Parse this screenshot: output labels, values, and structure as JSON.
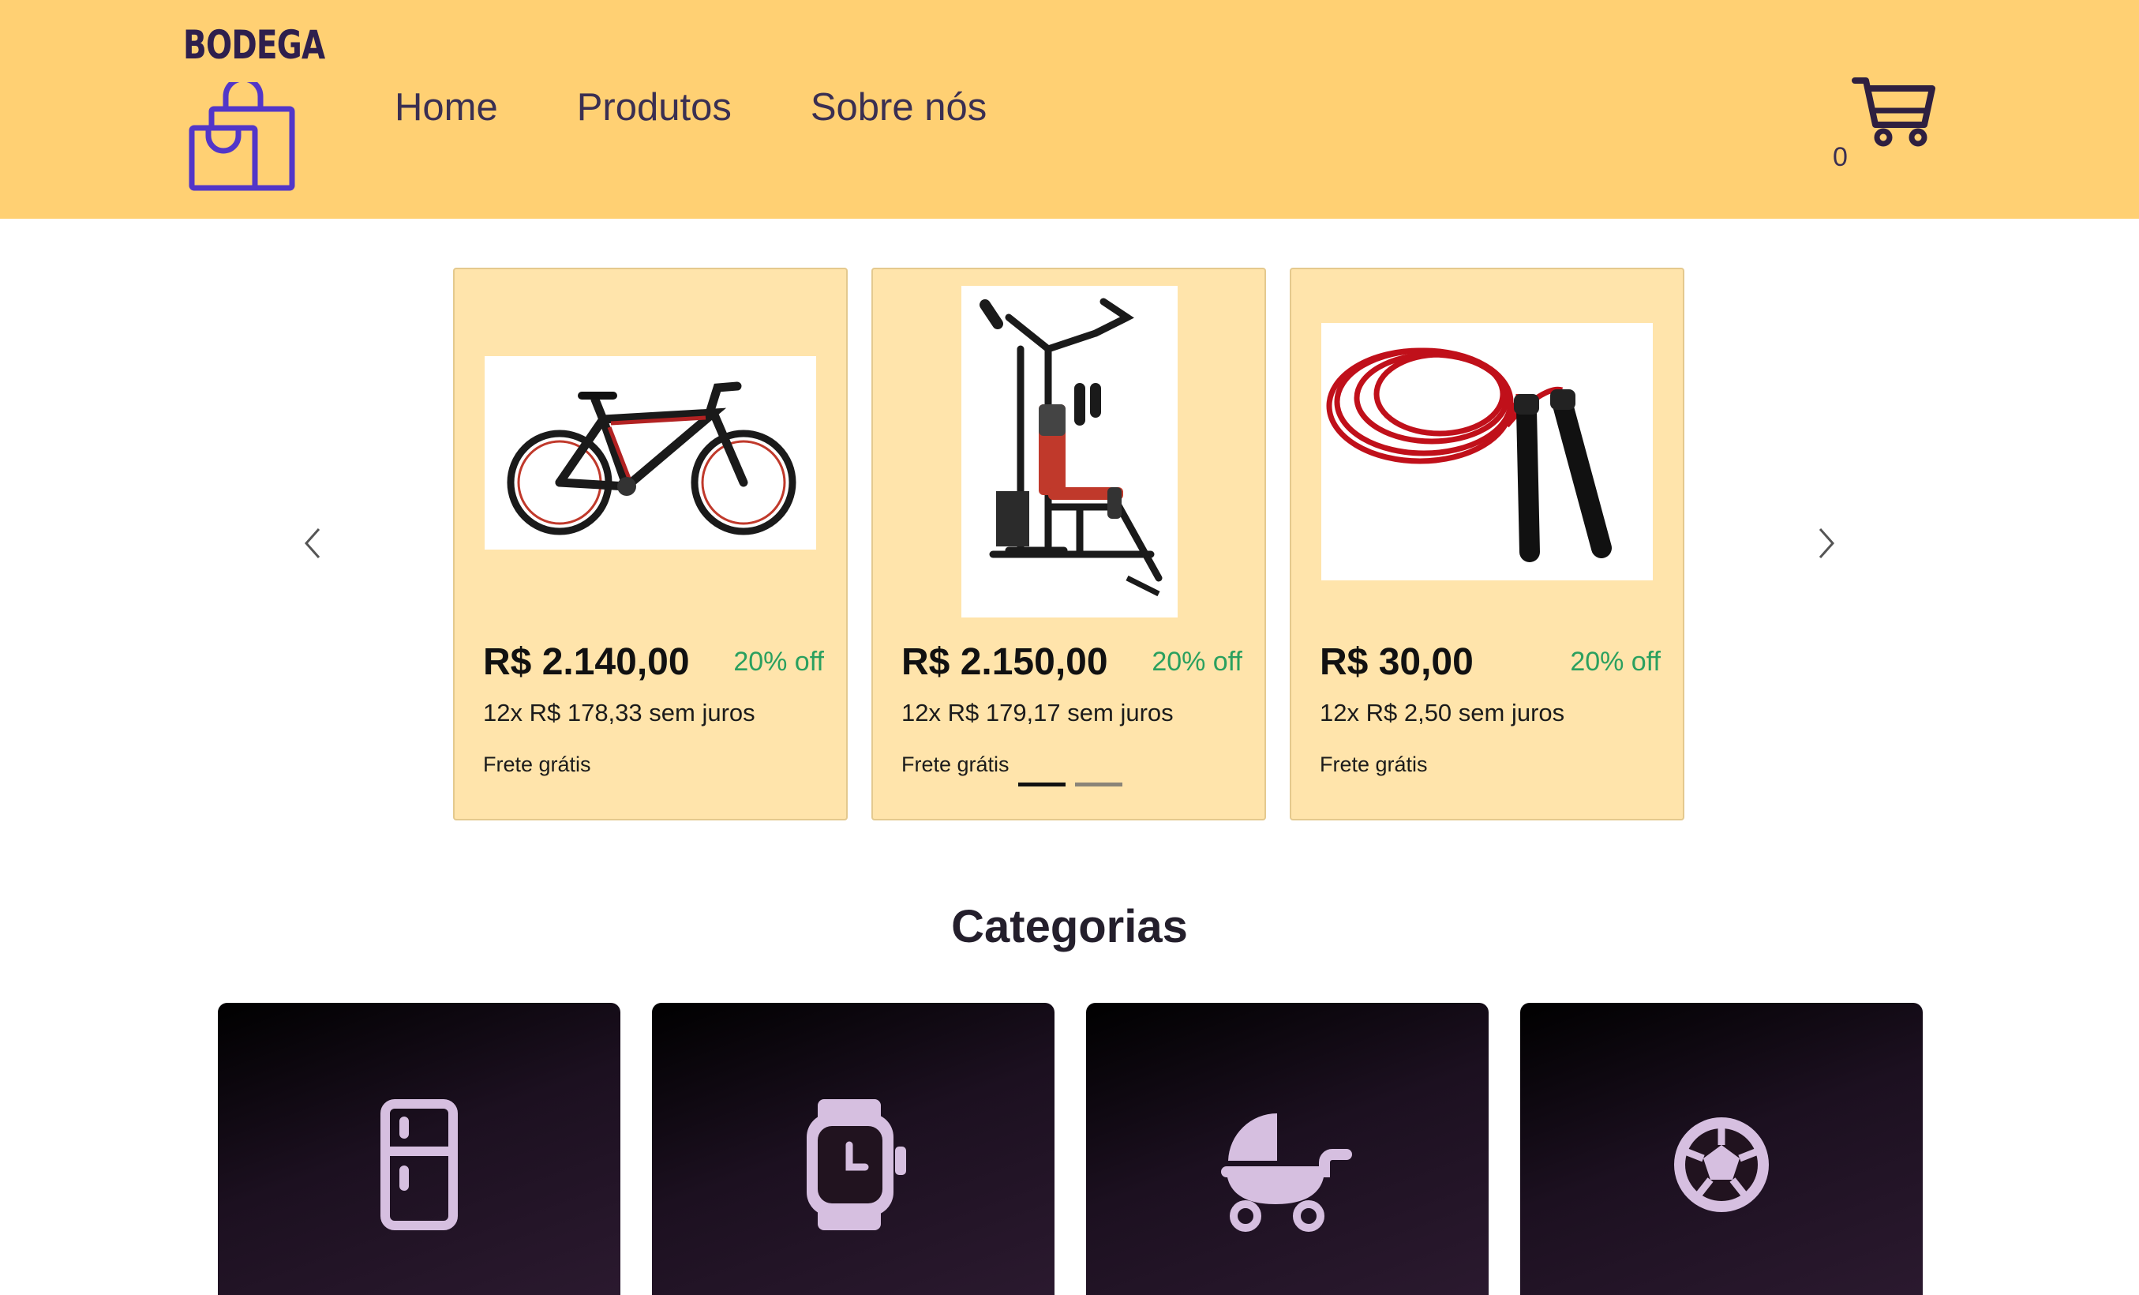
{
  "brand": {
    "name": "BODEGA",
    "logo_icon": "shopping-bag-icon"
  },
  "nav": {
    "items": [
      {
        "label": "Home"
      },
      {
        "label": "Produtos"
      },
      {
        "label": "Sobre nós"
      }
    ]
  },
  "cart": {
    "icon": "cart-icon",
    "count": "0"
  },
  "carousel": {
    "prev_icon": "chevron-left-icon",
    "next_icon": "chevron-right-icon",
    "products": [
      {
        "image": "bicycle-image",
        "price": "R$ 2.140,00",
        "discount": "20% off",
        "installments": "12x R$ 178,33 sem juros",
        "shipping": "Frete grátis"
      },
      {
        "image": "home-gym-image",
        "price": "R$ 2.150,00",
        "discount": "20% off",
        "installments": "12x R$ 179,17 sem juros",
        "shipping": "Frete grátis"
      },
      {
        "image": "jump-rope-image",
        "price": "R$ 30,00",
        "discount": "20% off",
        "installments": "12x R$ 2,50 sem juros",
        "shipping": "Frete grátis"
      }
    ],
    "indicators": [
      "active",
      "inactive"
    ]
  },
  "categories": {
    "title": "Categorias",
    "items": [
      {
        "icon": "refrigerator-icon"
      },
      {
        "icon": "smartwatch-icon"
      },
      {
        "icon": "baby-stroller-icon"
      },
      {
        "icon": "soccer-ball-icon"
      }
    ]
  },
  "colors": {
    "header_bg": "#ffd073",
    "card_bg": "#ffe4ab",
    "discount": "#2aa05f",
    "logo_purple": "#5236c8",
    "category_icon": "#d6bfe0"
  }
}
